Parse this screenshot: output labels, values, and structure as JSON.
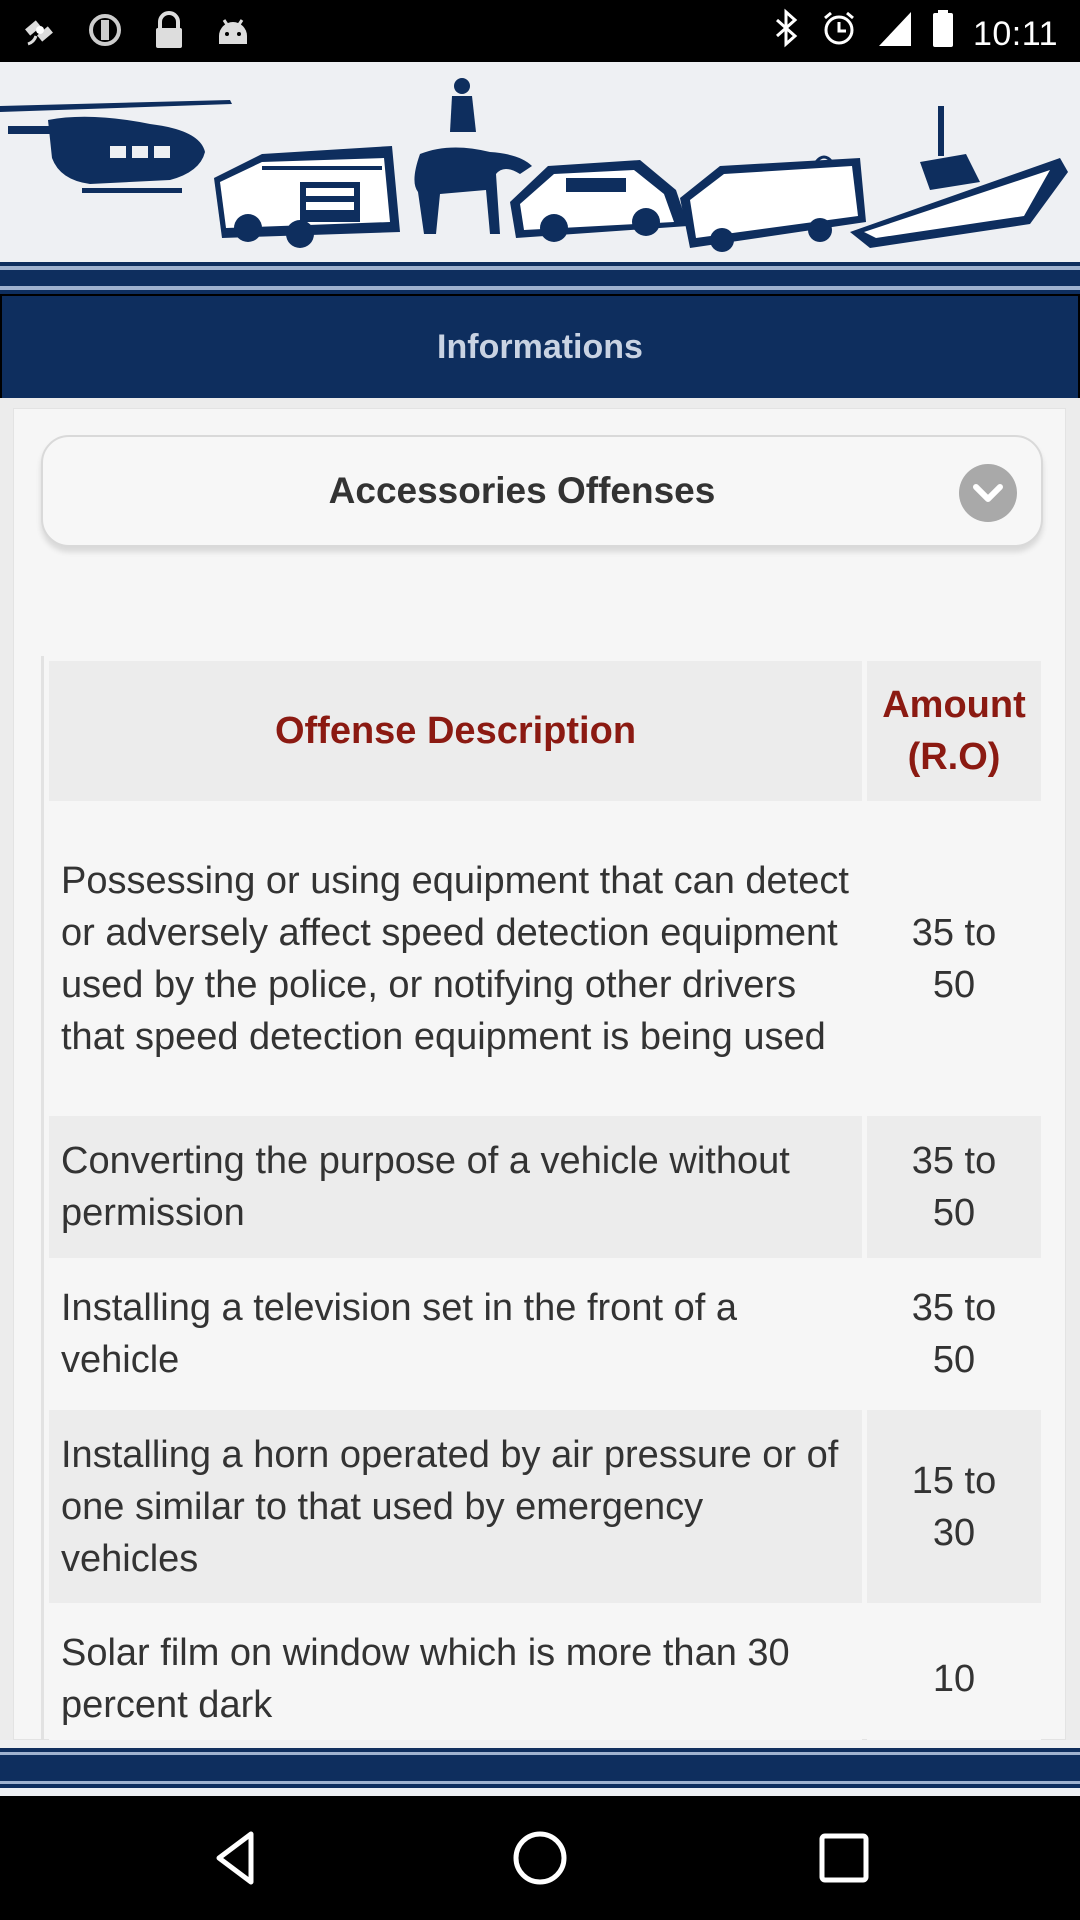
{
  "status_bar": {
    "time": "10:11",
    "left_icons": [
      "satellite-icon",
      "sync-icon",
      "lock-icon",
      "android-icon"
    ],
    "right_icons": [
      "bluetooth-icon",
      "alarm-icon",
      "signal-icon",
      "battery-icon"
    ]
  },
  "header": {
    "title": "Informations"
  },
  "category_select": {
    "selected": "Accessories Offenses"
  },
  "table": {
    "headers": {
      "description": "Offense Description",
      "amount": "Amount (R.O)"
    },
    "rows": [
      {
        "description": "Possessing or using equipment that can detect or adversely affect speed detection equipment used by the police, or notifying other drivers that speed detection equipment is being used",
        "amount": "35 to 50"
      },
      {
        "description": "Converting the purpose of a vehicle without permission",
        "amount": "35 to 50"
      },
      {
        "description": "Installing a television set in the front of a vehicle",
        "amount": "35 to 50"
      },
      {
        "description": "Installing a horn operated by air pressure or of one similar to that used by emergency vehicles",
        "amount": "15 to 30"
      },
      {
        "description": "Solar film on window which is more than 30 percent dark",
        "amount": "10"
      }
    ]
  },
  "colors": {
    "navy": "#0e2e5e",
    "header_text": "#8b1a12",
    "banner_bg": "#eef0f3"
  },
  "nav": {
    "icons": [
      "back-icon",
      "home-icon",
      "recents-icon"
    ]
  }
}
